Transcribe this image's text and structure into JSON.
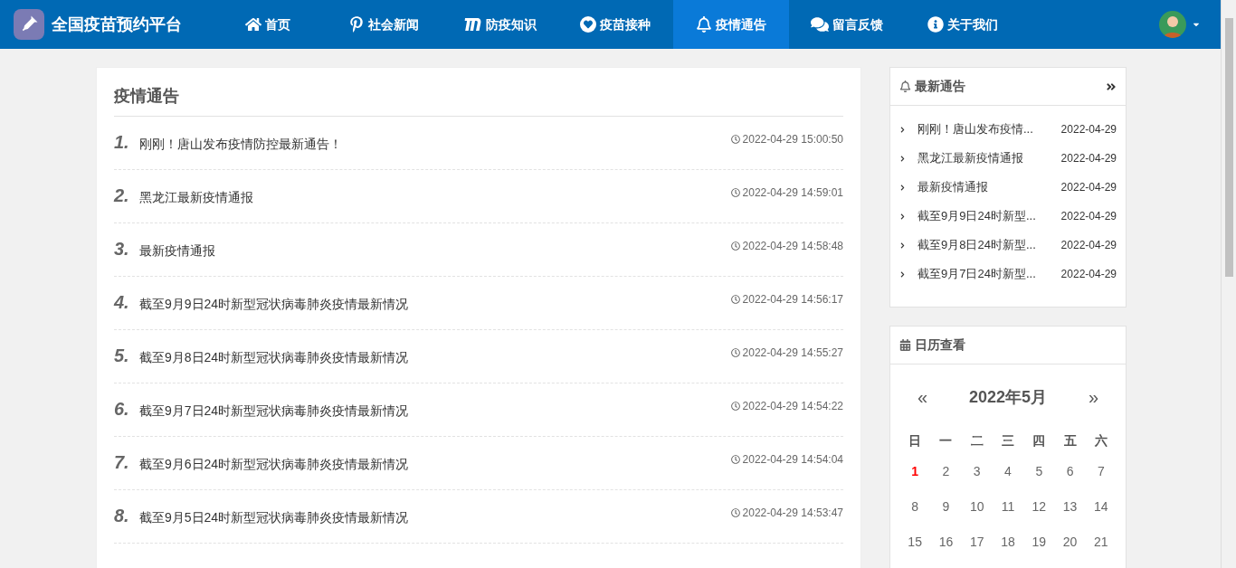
{
  "brand": {
    "name": "全国疫苗预约平台"
  },
  "nav": [
    {
      "label": "首页",
      "kind": "home",
      "selected": false
    },
    {
      "label": "社会新闻",
      "kind": "pin",
      "selected": false
    },
    {
      "label": "防疫知识",
      "kind": "m",
      "selected": false
    },
    {
      "label": "疫苗接种",
      "kind": "heart",
      "selected": false
    },
    {
      "label": "疫情通告",
      "kind": "bell",
      "selected": true
    },
    {
      "label": "留言反馈",
      "kind": "chat",
      "selected": false
    },
    {
      "label": "关于我们",
      "kind": "info",
      "selected": false
    }
  ],
  "main": {
    "title": "疫情通告",
    "items": [
      {
        "index": "1.",
        "title": "刚刚！唐山发布疫情防控最新通告！",
        "time": "2022-04-29 15:00:50"
      },
      {
        "index": "2.",
        "title": "黑龙江最新疫情通报",
        "time": "2022-04-29 14:59:01"
      },
      {
        "index": "3.",
        "title": "最新疫情通报",
        "time": "2022-04-29 14:58:48"
      },
      {
        "index": "4.",
        "title": "截至9月9日24时新型冠状病毒肺炎疫情最新情况",
        "time": "2022-04-29 14:56:17"
      },
      {
        "index": "5.",
        "title": "截至9月8日24时新型冠状病毒肺炎疫情最新情况",
        "time": "2022-04-29 14:55:27"
      },
      {
        "index": "6.",
        "title": "截至9月7日24时新型冠状病毒肺炎疫情最新情况",
        "time": "2022-04-29 14:54:22"
      },
      {
        "index": "7.",
        "title": "截至9月6日24时新型冠状病毒肺炎疫情最新情况",
        "time": "2022-04-29 14:54:04"
      },
      {
        "index": "8.",
        "title": "截至9月5日24时新型冠状病毒肺炎疫情最新情况",
        "time": "2022-04-29 14:53:47"
      }
    ]
  },
  "latest": {
    "title": "最新通告",
    "items": [
      {
        "title": "刚刚！唐山发布疫情...",
        "date": "2022-04-29"
      },
      {
        "title": "黑龙江最新疫情通报",
        "date": "2022-04-29"
      },
      {
        "title": "最新疫情通报",
        "date": "2022-04-29"
      },
      {
        "title": "截至9月9日24时新型...",
        "date": "2022-04-29"
      },
      {
        "title": "截至9月8日24时新型...",
        "date": "2022-04-29"
      },
      {
        "title": "截至9月7日24时新型...",
        "date": "2022-04-29"
      }
    ]
  },
  "calendar": {
    "title": "日历查看",
    "prev": "«",
    "month": "2022年5月",
    "next": "»",
    "weekdays": [
      "日",
      "一",
      "二",
      "三",
      "四",
      "五",
      "六"
    ],
    "days": [
      {
        "label": "1",
        "today": true
      },
      {
        "label": "2",
        "today": false
      },
      {
        "label": "3",
        "today": false
      },
      {
        "label": "4",
        "today": false
      },
      {
        "label": "5",
        "today": false
      },
      {
        "label": "6",
        "today": false
      },
      {
        "label": "7",
        "today": false
      },
      {
        "label": "8",
        "today": false
      },
      {
        "label": "9",
        "today": false
      },
      {
        "label": "10",
        "today": false
      },
      {
        "label": "11",
        "today": false
      },
      {
        "label": "12",
        "today": false
      },
      {
        "label": "13",
        "today": false
      },
      {
        "label": "14",
        "today": false
      },
      {
        "label": "15",
        "today": false
      },
      {
        "label": "16",
        "today": false
      },
      {
        "label": "17",
        "today": false
      },
      {
        "label": "18",
        "today": false
      },
      {
        "label": "19",
        "today": false
      },
      {
        "label": "20",
        "today": false
      },
      {
        "label": "21",
        "today": false
      }
    ]
  }
}
